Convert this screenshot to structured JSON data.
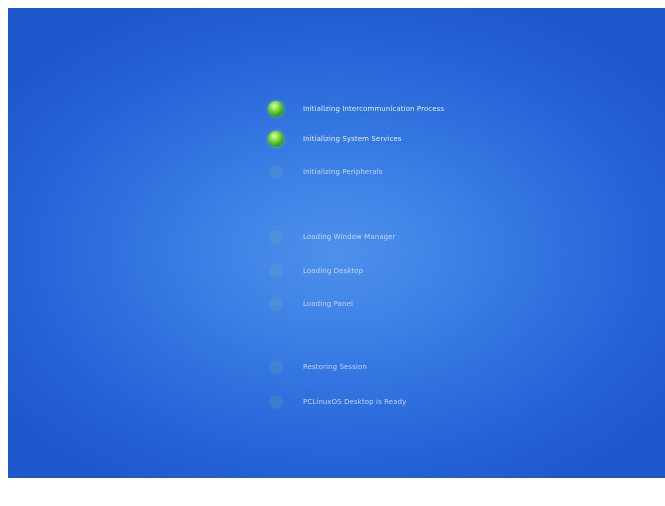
{
  "boot": {
    "steps": [
      {
        "label": "Initializing Intercommunication Process",
        "status": "done"
      },
      {
        "label": "Initializing System Services",
        "status": "done"
      },
      {
        "label": "Initializing Peripherals",
        "status": "pending"
      },
      {
        "label": "Loading Window Manager",
        "status": "pending"
      },
      {
        "label": "Loading Desktop",
        "status": "pending"
      },
      {
        "label": "Loading Panel",
        "status": "pending"
      },
      {
        "label": "Restoring Session",
        "status": "pending"
      },
      {
        "label": "PCLinuxOS Desktop is Ready",
        "status": "pending"
      }
    ]
  },
  "colors": {
    "background_center": "#4d90ec",
    "background_edge": "#1f58cc",
    "done_indicator": "#4cb424",
    "pending_indicator": "#7fbf94",
    "label_text": "#e4eeff"
  },
  "icons": {
    "done": "green-orb-icon",
    "pending": "dim-orb-icon"
  }
}
